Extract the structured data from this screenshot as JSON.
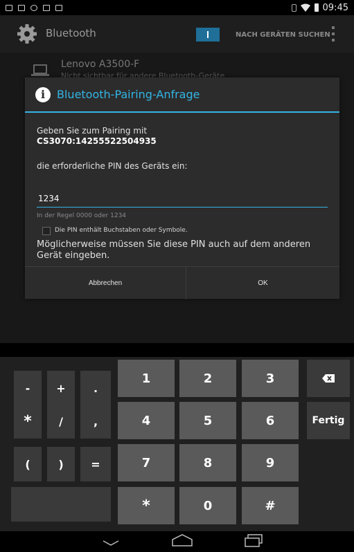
{
  "status_bar": {
    "time": "09:45"
  },
  "action_bar": {
    "title": "Bluetooth",
    "search_label": "NACH GERÄTEN SUCHEN"
  },
  "background_list": {
    "device_name": "Lenovo A3500-F",
    "device_sub": "Nicht sichtbar für andere Bluetooth-Geräte"
  },
  "dialog": {
    "title": "Bluetooth-Pairing-Anfrage",
    "message_line1": "Geben Sie zum Pairing mit",
    "device_id": "CS3070:14255522504935",
    "message_line2": "die erforderliche PIN des Geräts ein:",
    "pin_value": "1234",
    "pin_hint": "In der Regel 0000 oder 1234",
    "checkbox_label": "Die PIN enthält Buchstaben oder Symbole.",
    "message_line3": "Möglicherweise müssen Sie diese PIN auch auf dem anderen Gerät eingeben.",
    "cancel_label": "Abbrechen",
    "ok_label": "OK"
  },
  "keyboard": {
    "symbols": [
      "-",
      "+",
      ".",
      "*",
      "/",
      ",",
      "(",
      ")",
      "="
    ],
    "digits": [
      "1",
      "2",
      "3",
      "4",
      "5",
      "6",
      "7",
      "8",
      "9",
      "*",
      "0",
      "#"
    ],
    "done_label": "Fertig"
  },
  "colors": {
    "accent": "#33b5e5",
    "switch": "#1f6f99"
  }
}
